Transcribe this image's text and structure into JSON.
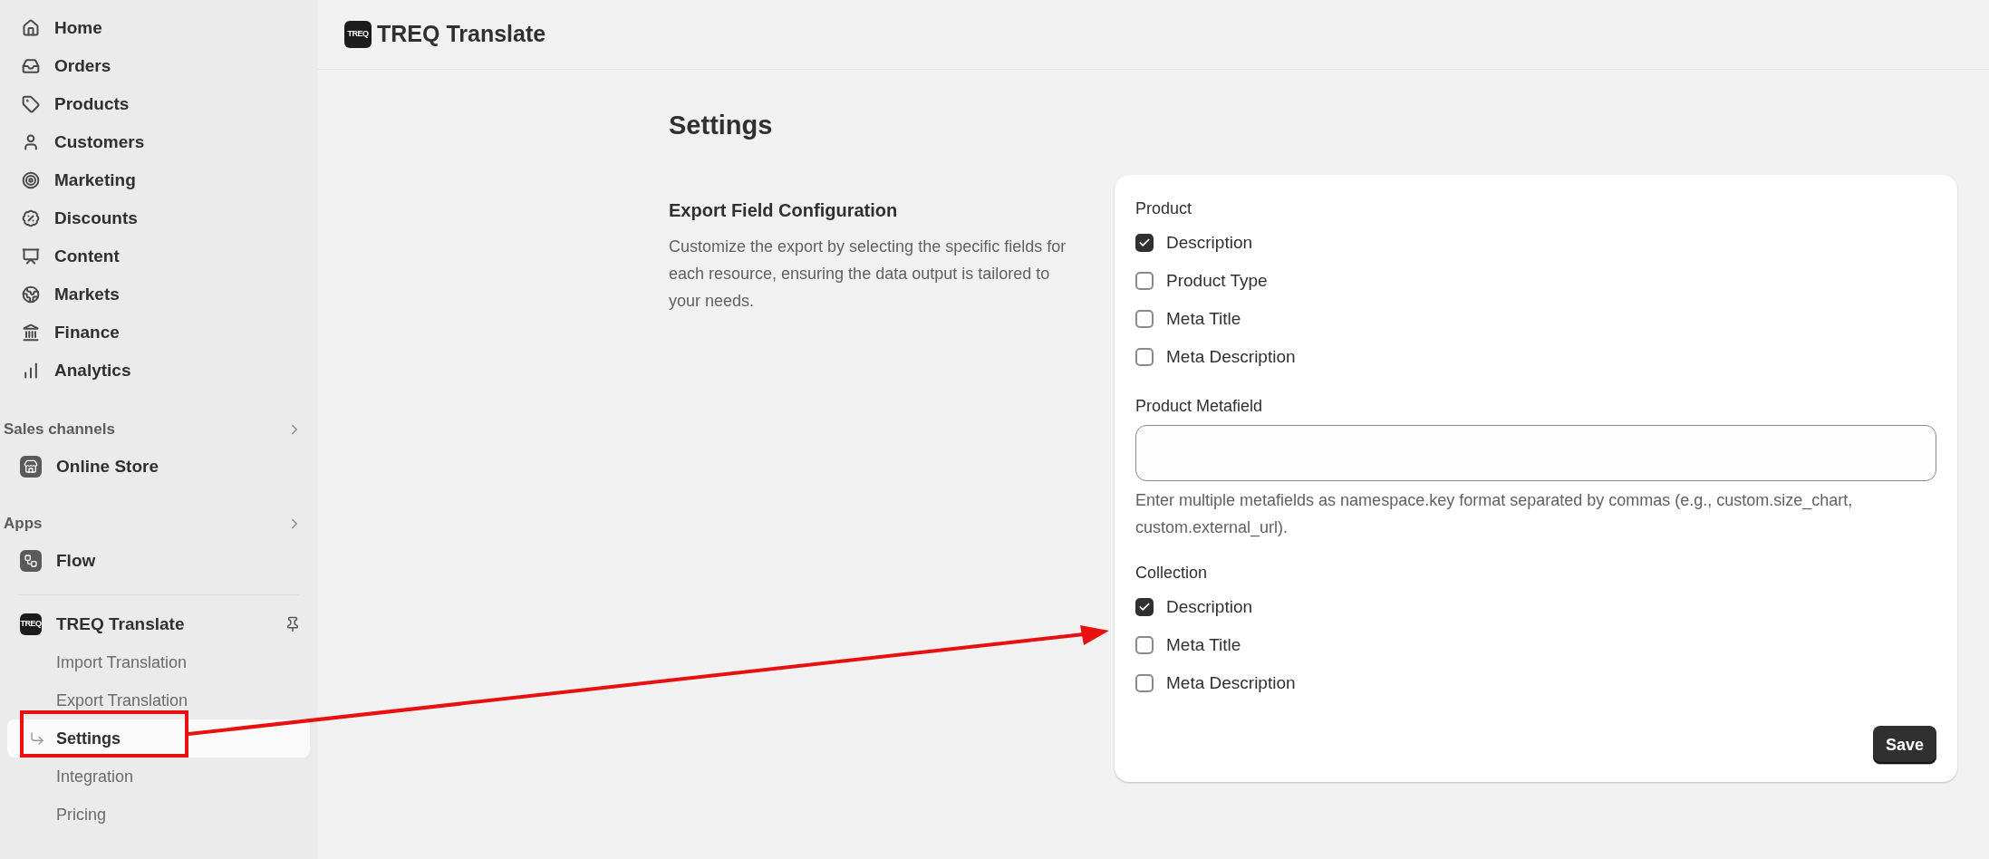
{
  "header": {
    "logo_text": "TREQ",
    "title": "TREQ Translate"
  },
  "sidebar": {
    "main_items": [
      {
        "label": "Home"
      },
      {
        "label": "Orders"
      },
      {
        "label": "Products"
      },
      {
        "label": "Customers"
      },
      {
        "label": "Marketing"
      },
      {
        "label": "Discounts"
      },
      {
        "label": "Content"
      },
      {
        "label": "Markets"
      },
      {
        "label": "Finance"
      },
      {
        "label": "Analytics"
      }
    ],
    "sections": [
      {
        "title": "Sales channels",
        "items": [
          {
            "label": "Online Store"
          }
        ]
      },
      {
        "title": "Apps",
        "items": [
          {
            "label": "Flow"
          }
        ]
      }
    ],
    "app": {
      "logo_text": "TREQ",
      "label": "TREQ Translate",
      "subitems": [
        {
          "label": "Import Translation",
          "selected": false
        },
        {
          "label": "Export Translation",
          "selected": false
        },
        {
          "label": "Settings",
          "selected": true
        },
        {
          "label": "Integration",
          "selected": false
        },
        {
          "label": "Pricing",
          "selected": false
        }
      ]
    }
  },
  "page": {
    "title": "Settings",
    "section_title": "Export Field Configuration",
    "section_description": "Customize the export by selecting the specific fields for each resource, ensuring the data output is tailored to your needs.",
    "groups": [
      {
        "kind": "checkboxes",
        "title": "Product",
        "options": [
          {
            "label": "Description",
            "checked": true
          },
          {
            "label": "Product Type",
            "checked": false
          },
          {
            "label": "Meta Title",
            "checked": false
          },
          {
            "label": "Meta Description",
            "checked": false
          }
        ]
      },
      {
        "kind": "text_input",
        "title": "Product Metafield",
        "help": "Enter multiple metafields as namespace.key format separated by commas (e.g., custom.size_chart, custom.external_url)."
      },
      {
        "kind": "checkboxes",
        "title": "Collection",
        "options": [
          {
            "label": "Description",
            "checked": true
          },
          {
            "label": "Meta Title",
            "checked": false
          },
          {
            "label": "Meta Description",
            "checked": false
          }
        ]
      }
    ],
    "save_button": "Save"
  }
}
